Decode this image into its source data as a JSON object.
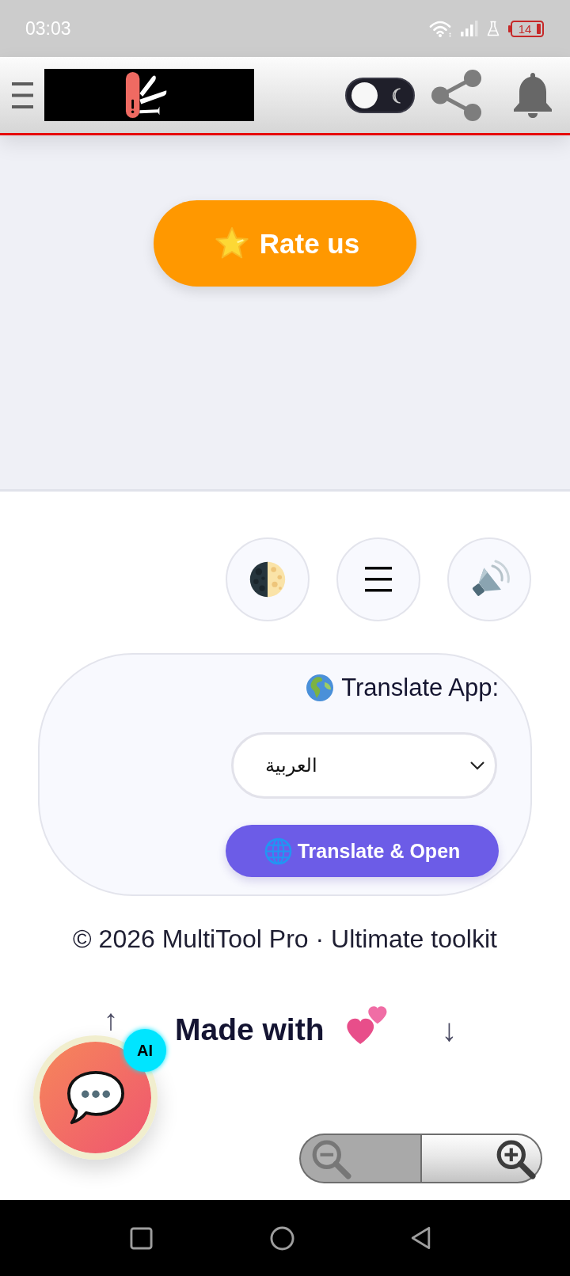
{
  "status_bar": {
    "time": "03:03",
    "battery": "14"
  },
  "header": {
    "theme_toggle": {
      "on": false
    }
  },
  "rate_button": {
    "label": "Rate us"
  },
  "translate": {
    "label": "Translate App:",
    "language": "العربية",
    "button": "Translate & Open"
  },
  "footer": {
    "copyright": "© 2026 MultiTool Pro · Ultimate toolkit",
    "scroll_up": "↑",
    "made_with": "Made with",
    "scroll_down": "↓"
  },
  "chat": {
    "badge": "AI"
  },
  "zoom_controls": [
    {
      "kind": "zoom_out",
      "disabled": true
    },
    {
      "kind": "zoom_in",
      "disabled": false
    }
  ]
}
